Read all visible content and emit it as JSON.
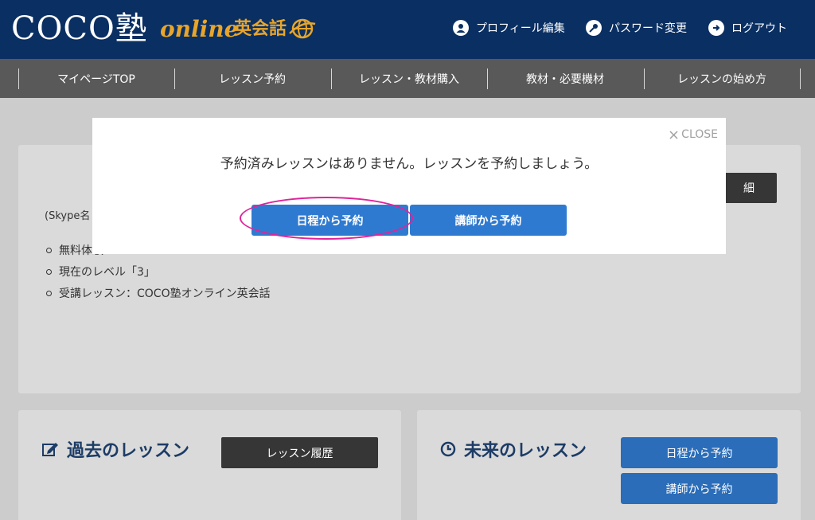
{
  "header": {
    "logo_text": "COCO塾",
    "logo_online": "online",
    "logo_eikaiwa": "英会話",
    "links": [
      {
        "label": "プロフィール編集",
        "icon": "user-icon"
      },
      {
        "label": "パスワード変更",
        "icon": "key-icon"
      },
      {
        "label": "ログアウト",
        "icon": "logout-icon"
      }
    ]
  },
  "nav": {
    "items": [
      "マイページTOP",
      "レッスン予約",
      "レッスン・教材購入",
      "教材・必要機材",
      "レッスンの始め方"
    ]
  },
  "main": {
    "skype_prefix": "(Skype名",
    "partial_line": "無料体験",
    "bullets": [
      "現在のレベル「3」",
      "受講レッスン：COCO塾オンライン英会話"
    ],
    "top_button_partial": "細"
  },
  "past": {
    "title": "過去のレッスン",
    "history_button": "レッスン履歴"
  },
  "future": {
    "title": "未来のレッスン",
    "by_schedule_button": "日程から予約",
    "by_teacher_button": "講師から予約"
  },
  "modal": {
    "close_label": "CLOSE",
    "message": "予約済みレッスンはありません。レッスンを予約しましょう。",
    "by_schedule_button": "日程から予約",
    "by_teacher_button": "講師から予約"
  },
  "colors": {
    "header_bg": "#0a2f62",
    "nav_bg": "#595959",
    "accent_orange": "#e8a52a",
    "button_blue": "#2f7ad1",
    "highlight_magenta": "#e0239b"
  }
}
